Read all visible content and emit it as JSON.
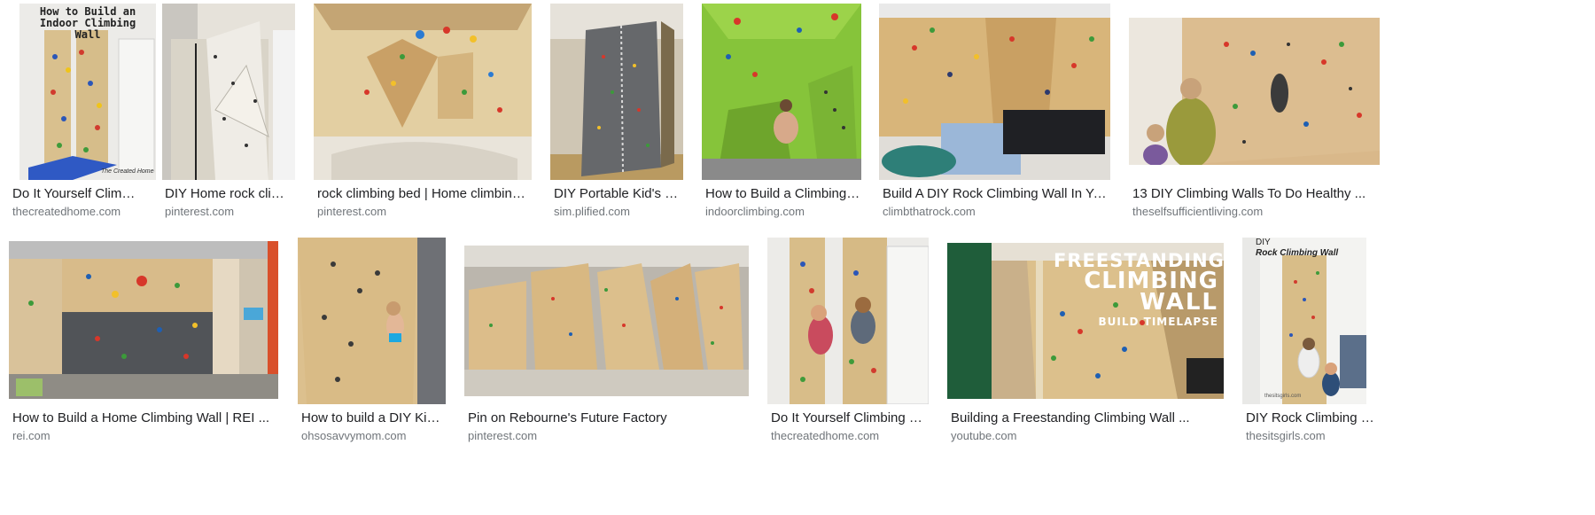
{
  "results": [
    {
      "title": "Do It Yourself Climbing...",
      "source": "thecreatedhome.com",
      "overlay": "How to Build an Indoor Climbing Wall",
      "overlay2": "The Created Home"
    },
    {
      "title": "DIY Home rock climbin...",
      "source": "pinterest.com"
    },
    {
      "title": "rock climbing bed | Home climbing wall ...",
      "source": "pinterest.com"
    },
    {
      "title": "DIY Portable Kid's Clim...",
      "source": "sim.plified.com"
    },
    {
      "title": "How to Build a Climbing Wall",
      "source": "indoorclimbing.com"
    },
    {
      "title": "Build A DIY Rock Climbing Wall In Your ...",
      "source": "climbthatrock.com"
    },
    {
      "title": "13 DIY Climbing Walls To Do Healthy ...",
      "source": "theselfsufficientliving.com"
    },
    {
      "title": "How to Build a Home Climbing Wall | REI ...",
      "source": "rei.com"
    },
    {
      "title": "How to build a DIY Kids Cl...",
      "source": "ohsosavvymom.com"
    },
    {
      "title": "Pin on Rebourne's Future Factory",
      "source": "pinterest.com"
    },
    {
      "title": "Do It Yourself Climbing Wall ...",
      "source": "thecreatedhome.com"
    },
    {
      "title": "Building a Freestanding Climbing Wall ...",
      "source": "youtube.com",
      "overlay": "FREESTANDING",
      "overlay2": "CLIMBING",
      "overlay3": "WALL",
      "overlay4": "BUILD TIMELAPSE"
    },
    {
      "title": "DIY Rock Climbing Wall ...",
      "source": "thesitsgirls.com",
      "overlay": "DIY",
      "overlay2": "Rock Climbing Wall",
      "overlay3": "thesitsgirls.com"
    }
  ]
}
